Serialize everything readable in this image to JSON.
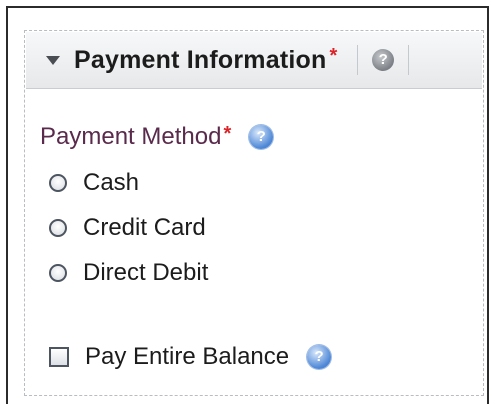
{
  "panel": {
    "title": "Payment Information",
    "required_mark": "*",
    "help_icon": "help-icon"
  },
  "payment_method": {
    "label": "Payment Method",
    "required_mark": "*",
    "help_icon": "help-icon",
    "options": [
      {
        "label": "Cash",
        "selected": false
      },
      {
        "label": "Credit Card",
        "selected": false
      },
      {
        "label": "Direct Debit",
        "selected": false
      }
    ]
  },
  "pay_entire_balance": {
    "label": "Pay Entire Balance",
    "checked": false,
    "help_icon": "help-icon"
  },
  "colors": {
    "required": "#d9252a",
    "label": "#5a2a4c",
    "help_blue": "#4c86d6"
  }
}
